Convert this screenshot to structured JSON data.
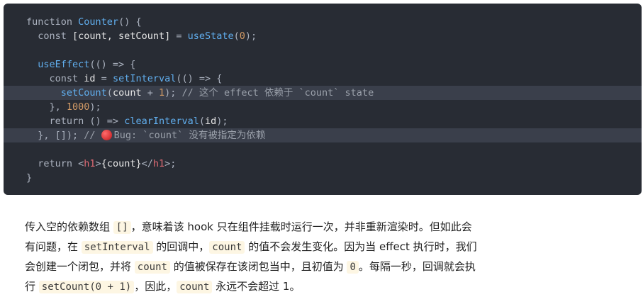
{
  "code": {
    "l1": {
      "kw": "function ",
      "fn": "Counter",
      "rest": "() {"
    },
    "l2": {
      "kw": "  const ",
      "plain": "[count, setCount]",
      "op": " = ",
      "fn": "useState",
      "p1": "(",
      "num": "0",
      "p2": ");"
    },
    "l4": {
      "fn": "  useEffect",
      "rest": "(() => {"
    },
    "l5": {
      "kw": "    const ",
      "plain": "id",
      "op": " = ",
      "fn": "setInterval",
      "rest": "(() => {"
    },
    "l6": {
      "fn": "      setCount",
      "p1": "(",
      "plain": "count",
      "op": " + ",
      "num": "1",
      "p2": "); ",
      "cm": "// 这个 effect 依赖于 `count` state"
    },
    "l7": {
      "p1": "    }, ",
      "num": "1000",
      "p2": ");"
    },
    "l8": {
      "kw": "    return ",
      "p1": "() => ",
      "fn": "clearInterval",
      "p2": "(",
      "plain": "id",
      "p3": ");"
    },
    "l9": {
      "p1": "  }, []); ",
      "cm1": "// ",
      "cm2": "Bug: `count` 没有被指定为依赖"
    },
    "l11": {
      "kw": "  return ",
      "p1": "<",
      "tag1": "h1",
      "p2": ">",
      "plain": "{count}",
      "p3": "</",
      "tag2": "h1",
      "p4": ">;"
    },
    "l12": {
      "p1": "}"
    }
  },
  "paragraph": {
    "line1": {
      "t1": "传入空的依赖数组 ",
      "c1": "[]",
      "t2": "，意味着该 hook 只在组件挂载时运行一次，并非重新渲染时。但如此会"
    },
    "line2": {
      "t1": "有问题，在 ",
      "c1": "setInterval",
      "t2": " 的回调中，",
      "c2": "count",
      "t3": " 的值不会发生变化。因为当 effect 执行时，我们"
    },
    "line3": {
      "t1": "会创建一个闭包，并将 ",
      "c1": "count",
      "t2": " 的值被保存在该闭包当中，且初值为 ",
      "c2": "0",
      "t3": "。每隔一秒，回调就会执"
    },
    "line4": {
      "t1": "行 ",
      "c1": "setCount(0 + 1)",
      "t2": "，因此，",
      "c2": "count",
      "t3": " 永远不会超过 1。"
    }
  }
}
